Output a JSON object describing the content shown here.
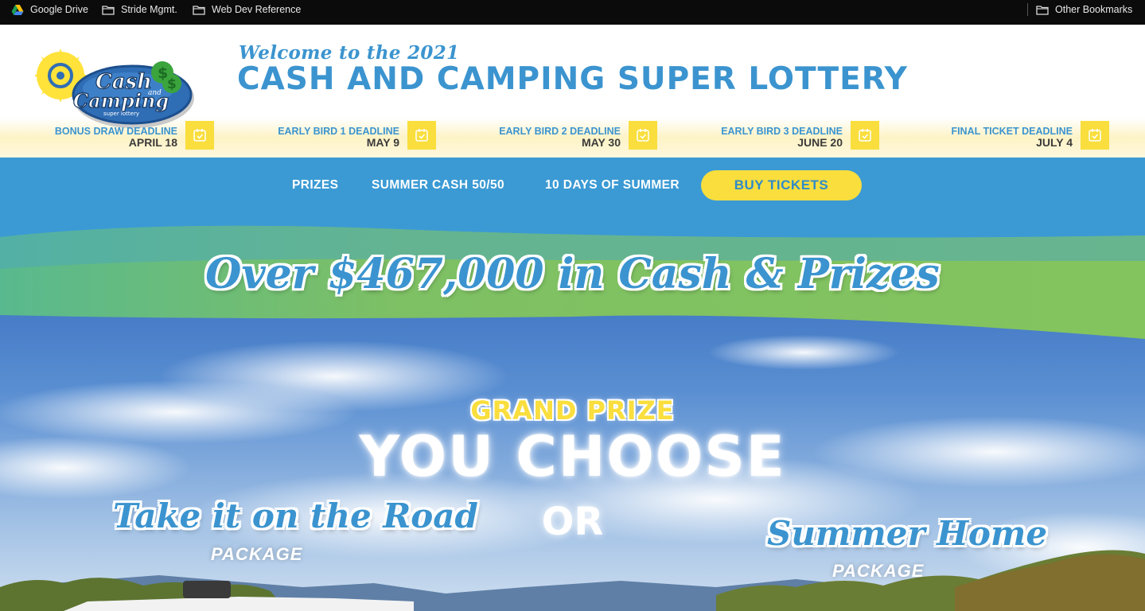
{
  "bookmarks": {
    "items": [
      {
        "label": "Google Drive",
        "icon": "google-drive-icon"
      },
      {
        "label": "Stride Mgmt.",
        "icon": "folder-icon"
      },
      {
        "label": "Web Dev Reference",
        "icon": "folder-icon"
      }
    ],
    "other": {
      "label": "Other Bookmarks",
      "icon": "folder-icon"
    }
  },
  "header": {
    "logo": {
      "line1": "Cash",
      "line2": "and",
      "line3": "Camping",
      "line4": "super lottery"
    },
    "welcome": "Welcome to the 2021",
    "title": "CASH AND CAMPING SUPER LOTTERY"
  },
  "deadlines": [
    {
      "label": "BONUS DRAW DEADLINE",
      "date": "APRIL 18"
    },
    {
      "label": "EARLY BIRD 1 DEADLINE",
      "date": "MAY 9"
    },
    {
      "label": "EARLY BIRD 2 DEADLINE",
      "date": "MAY 30"
    },
    {
      "label": "EARLY BIRD 3 DEADLINE",
      "date": "JUNE 20"
    },
    {
      "label": "FINAL TICKET DEADLINE",
      "date": "JULY 4"
    }
  ],
  "nav": {
    "links": [
      "PRIZES",
      "SUMMER CASH 50/50",
      "10 DAYS OF SUMMER"
    ],
    "cta": "BUY TICKETS"
  },
  "hero": {
    "banner": "Over $467,000 in Cash & Prizes",
    "grand": "GRAND PRIZE",
    "choose": "YOU CHOOSE",
    "or": "OR",
    "road_title": "Take it on the Road",
    "road_sub": "PACKAGE",
    "home_title": "Summer Home",
    "home_sub": "PACKAGE"
  },
  "colors": {
    "brand_blue": "#3b94cf",
    "nav_blue": "#3b9ad4",
    "accent_yellow": "#f9de3d",
    "banner_green": "#84c45e"
  }
}
